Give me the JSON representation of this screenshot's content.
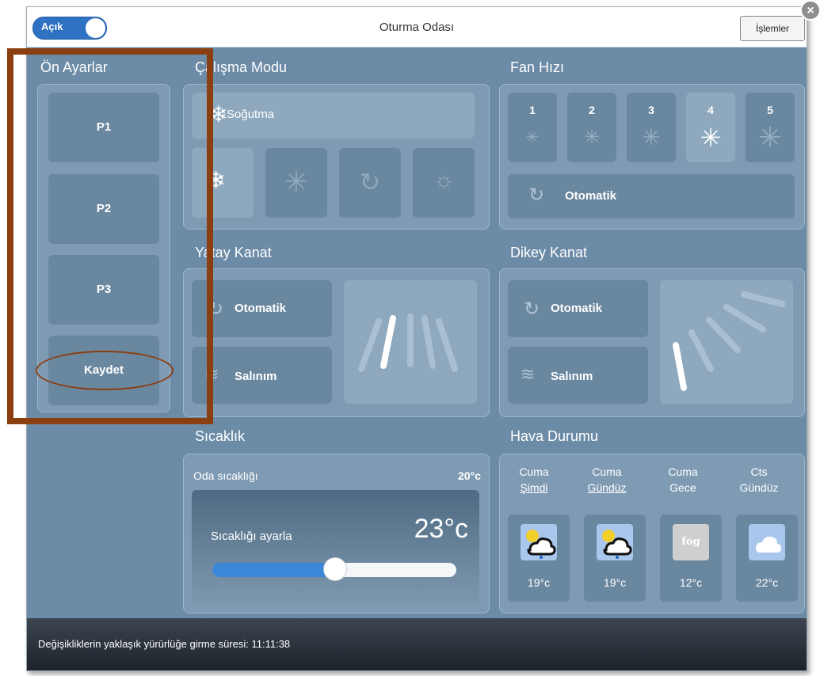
{
  "header": {
    "power_label": "Açık",
    "title": "Oturma Odası",
    "actions_label": "İşlemler",
    "close_glyph": "×"
  },
  "presets": {
    "title": "Ön Ayarlar",
    "items": [
      "P1",
      "P2",
      "P3"
    ],
    "save_label": "Kaydet"
  },
  "mode": {
    "title": "Çalışma Modu",
    "selected_label": "Soğutma",
    "icons": [
      "snowflake-icon",
      "asterisk-icon",
      "recycle-icon",
      "sun-icon"
    ]
  },
  "fan": {
    "title": "Fan Hızı",
    "levels": [
      "1",
      "2",
      "3",
      "4",
      "5"
    ],
    "selected": "4",
    "auto_label": "Otomatik"
  },
  "horizontal_vane": {
    "title": "Yatay Kanat",
    "auto_label": "Otomatik",
    "swing_label": "Salınım"
  },
  "vertical_vane": {
    "title": "Dikey Kanat",
    "auto_label": "Otomatik",
    "swing_label": "Salınım"
  },
  "temperature": {
    "title": "Sıcaklık",
    "room_label": "Oda sıcaklığı",
    "room_value": "20°c",
    "set_label": "Sıcaklığı ayarla",
    "set_value": "23°c",
    "slider_fraction": 0.5
  },
  "weather": {
    "title": "Hava Durumu",
    "days": [
      {
        "day": "Cuma",
        "period": "Şimdi",
        "icon": "sun-cloud-rain-icon",
        "temp": "19°c"
      },
      {
        "day": "Cuma",
        "period": "Gündüz",
        "icon": "sun-cloud-rain-icon",
        "temp": "19°c"
      },
      {
        "day": "Cuma",
        "period": "Gece",
        "icon": "fog-icon",
        "icon_text": "fog",
        "temp": "12°c"
      },
      {
        "day": "Cts",
        "period": "Gündüz",
        "icon": "cloud-icon",
        "temp": "22°c"
      }
    ]
  },
  "status": {
    "text": "Değişikliklerin yaklaşık yürürlüğe girme süresi: 11:11:38"
  },
  "colors": {
    "background": "#6b8ba6",
    "panel": "#7f9bb3",
    "tile": "#6a87a0",
    "toggle": "#2f72c4",
    "highlight": "#8b3e0f"
  }
}
